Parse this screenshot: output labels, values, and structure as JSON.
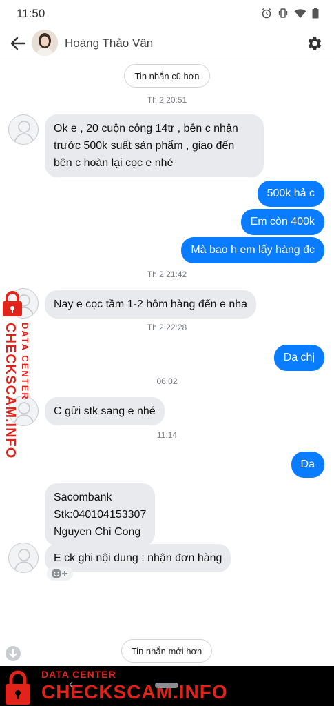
{
  "status_bar": {
    "time": "11:50"
  },
  "header": {
    "contact_name": "Hoàng Thảo Vân"
  },
  "older_button": "Tin nhắn cũ hơn",
  "newer_button": "Tin nhắn mới hơn",
  "timestamps": [
    "Th 2 20:51",
    "Th 2 21:42",
    "Th 2 22:28",
    "06:02",
    "11:14"
  ],
  "messages": {
    "in1": [
      "Ok e , 20 cuộn công 14tr , bên c nhận",
      "trước 500k suất sản phẩm , giao đến",
      "bên c hoàn lại cọc e nhé"
    ],
    "out1": "500k hả c",
    "out2": "Em còn 400k",
    "out3": "Mà bao h em lấy hàng đc",
    "in2": "Nay e cọc tầm 1-2 hôm hàng đến e nha",
    "out4": "Da chị",
    "in3": "C gửi stk sang e nhé",
    "out5": "Da",
    "in4": [
      "Sacombank",
      "Stk:040104153307",
      "Nguyen Chi Cong"
    ],
    "in5": "E ck ghi nội dung : nhận đơn hàng"
  },
  "watermark": {
    "line1": "DATA CENTER",
    "line2": "CHECKSCAM.INFO"
  },
  "colors": {
    "outgoing": "#0a7cff",
    "incoming": "#e9eaed",
    "watermark": "#e2231a"
  },
  "icons": [
    "alarm-icon",
    "vibrate-icon",
    "wifi-icon",
    "battery-icon",
    "back-arrow-icon",
    "settings-gear-icon",
    "add-reaction-icon",
    "scroll-down-icon",
    "lock-icon"
  ]
}
